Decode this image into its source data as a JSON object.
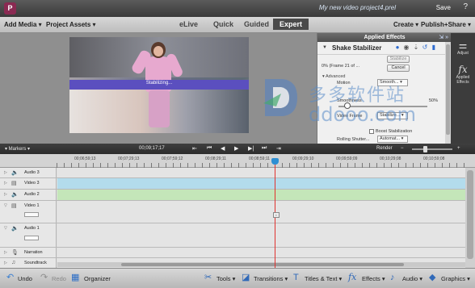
{
  "titlebar": {
    "project_title": "My new video project4.prel",
    "save_label": "Save",
    "help_label": "?"
  },
  "menubar": {
    "add_media": "Add Media ▾",
    "project_assets": "Project Assets ▾",
    "modes": [
      "eLive",
      "Quick",
      "Guided",
      "Expert"
    ],
    "active_mode": "Expert",
    "create": "Create ▾",
    "publish_share": "Publish+Share ▾"
  },
  "monitor": {
    "overlay_text": "Stabilizing..."
  },
  "effects": {
    "title": "Applied Effects",
    "effect_name": "Shake Stabilizer",
    "progress_text": "0% (Frame 21 of ...",
    "stabilize_button": "Stabilize",
    "cancel_button": "Cancel",
    "advanced_label": "▾ Advanced",
    "motion_label": "Motion",
    "motion_value": "Smooth...",
    "smoothness_label": "Smoothness",
    "smoothness_value": "50%",
    "smoothness_level": 0.1,
    "video_frame_label": "Video Frame",
    "video_frame_value": "Stabilize...",
    "boost_label": "Boost Stabilization",
    "rolling_label": "Rolling Shutter...",
    "rolling_value": "Automat..."
  },
  "side_panel": {
    "adjust_label": "Adjust",
    "applied_effects_label": "Applied Effects"
  },
  "timeline": {
    "markers_label": "▾ Markers ▾",
    "current_time": "00;09;17;17",
    "render_label": "Render",
    "ruler_labels": [
      "00;06;59;13",
      "00;07;29;13",
      "00;07;59;12",
      "00;08;29;11",
      "00;08;59;11",
      "00;09;29;10",
      "00;09;59;09",
      "00;10;29;08",
      "00;10;59;08"
    ]
  },
  "tracks": {
    "audio3": "Audio 3",
    "video3": "Video 3",
    "audio2": "Audio 2",
    "video1": "Video 1",
    "audio1": "Audio 1",
    "narration": "Narration",
    "soundtrack": "Soundtrack"
  },
  "actions": {
    "undo": "Undo",
    "redo": "Redo",
    "organizer": "Organizer",
    "tools": "Tools ▾",
    "transitions": "Transitions ▾",
    "titles_text": "Titles & Text ▾",
    "effects": "Effects ▾",
    "audio": "Audio ▾",
    "graphics": "Graphics ▾"
  },
  "watermark": {
    "cn": "多多软件站",
    "en": "ddooo.com"
  },
  "colors": {
    "stabilize_bar": "#5b4fbf",
    "video_clip": "#b3dcec",
    "audio_clip": "#c4e6b9",
    "playhead": "#e0322f"
  }
}
